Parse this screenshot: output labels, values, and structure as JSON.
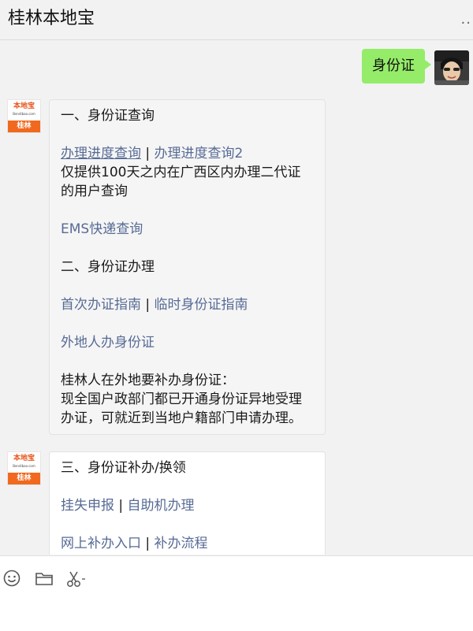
{
  "header": {
    "title": "桂林本地宝",
    "more_label": ".."
  },
  "user_message": {
    "text": "身份证"
  },
  "bot_avatar": {
    "logo_text": "本地宝",
    "logo_sub": "Bendibao.com",
    "logo_city": "桂林"
  },
  "message1": {
    "heading1": "一、身份证查询",
    "link_progress": "办理进度查询",
    "separator": "|",
    "link_progress2": "办理进度查询2",
    "note": "仅提供100天之内在广西区内办理二代证的用户查询",
    "link_ems": "EMS快递查询",
    "heading2": "二、身份证办理",
    "link_first": "首次办证指南",
    "link_temp": "临时身份证指南",
    "link_outsider": "外地人办身份证",
    "info_title": "桂林人在外地要补办身份证：",
    "info_body": "现全国户政部门都已开通身份证异地受理办证，可就近到当地户籍部门申请办理。"
  },
  "message2": {
    "heading": "三、身份证补办/换领",
    "link_loss": "挂失申报",
    "separator": "|",
    "link_self": "自助机办理",
    "link_online": "网上补办入口",
    "link_flow": "补办流程"
  },
  "input_bar": {
    "emoji_icon": "emoji-icon",
    "folder_icon": "folder-icon",
    "scissors_icon": "scissors-icon"
  }
}
